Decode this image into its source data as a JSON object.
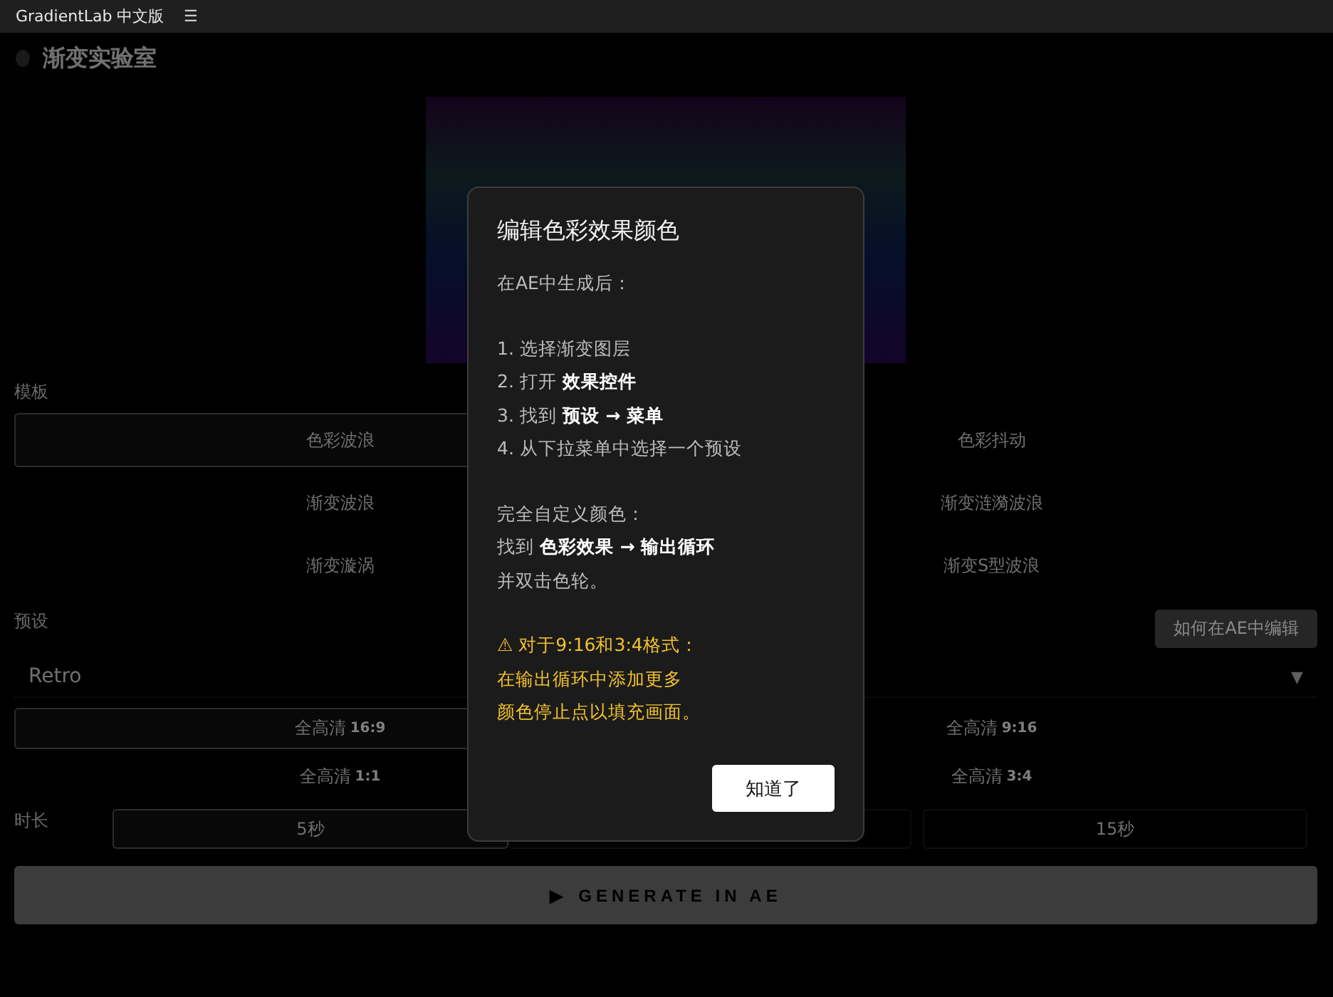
{
  "topbar": {
    "title": "GradientLab 中文版",
    "menu": "☰"
  },
  "header": {
    "title": "渐变实验室"
  },
  "templates": {
    "label": "模板",
    "items": [
      {
        "label": "色彩波浪",
        "selected": true
      },
      {
        "label": "色彩抖动",
        "selected": false
      },
      {
        "label": "渐变波浪",
        "selected": false
      },
      {
        "label": "渐变涟漪波浪",
        "selected": false
      },
      {
        "label": "渐变漩涡",
        "selected": false
      },
      {
        "label": "渐变S型波浪",
        "selected": false
      }
    ]
  },
  "presets": {
    "label": "预设",
    "help_button": "如何在AE中编辑",
    "select": {
      "value": "Retro",
      "arrow": "▼"
    }
  },
  "formats": [
    {
      "label": "全高清",
      "ratio": "16:9",
      "selected": true
    },
    {
      "label": "全高清",
      "ratio": "9:16",
      "selected": false
    },
    {
      "label": "全高清",
      "ratio": "1:1",
      "selected": false
    },
    {
      "label": "全高清",
      "ratio": "3:4",
      "selected": false
    }
  ],
  "duration": {
    "label": "时长",
    "options": [
      {
        "label": "5秒",
        "selected": true
      },
      {
        "selected": false
      },
      {
        "label": "15秒",
        "selected": false
      }
    ]
  },
  "generate_button": {
    "icon": "▶",
    "label": "GENERATE IN AE"
  },
  "modal": {
    "title": "编辑色彩效果颜色",
    "groups": [
      {
        "kind": "normal",
        "lines": [
          "在AE中生成后："
        ]
      },
      {
        "kind": "normal",
        "lines": [
          "1. 选择渐变图层",
          "2. 打开 **效果控件**",
          "3. 找到 **预设 → 菜单**",
          "4. 从下拉菜单中选择一个预设"
        ]
      },
      {
        "kind": "normal",
        "lines": [
          "完全自定义颜色：",
          "找到 **色彩效果 → 输出循环**",
          "并双击色轮。"
        ]
      },
      {
        "kind": "warning",
        "lines": [
          "⚠ 对于9:16和3:4格式：",
          "在输出循环中添加更多",
          "颜色停止点以填充画面。"
        ]
      }
    ],
    "button": "知道了"
  }
}
